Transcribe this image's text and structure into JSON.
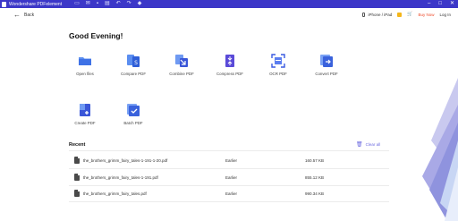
{
  "titlebar": {
    "app_title": "Wondershare PDFelement",
    "icons": [
      "open-file-icon",
      "mail-icon",
      "save-icon",
      "print-icon",
      "undo-icon",
      "redo-icon",
      "shield-icon"
    ],
    "window_controls": [
      "minimize-icon",
      "maximize-icon",
      "close-icon"
    ]
  },
  "header": {
    "back_label": "Back",
    "device_label": "iPhone / iPad",
    "buy_label": "Buy Now",
    "login_label": "Log In"
  },
  "greeting": "Good Evening!",
  "tools": [
    {
      "label": "Open files",
      "color": "#4a78e8"
    },
    {
      "label": "Compare PDF",
      "color": "#4a78e8"
    },
    {
      "label": "Combine PDF",
      "color": "#4a5ae0"
    },
    {
      "label": "Compress PDF",
      "color": "#5a4ae0"
    },
    {
      "label": "OCR PDF",
      "color": "#3a5ae0"
    },
    {
      "label": "Convert PDF",
      "color": "#4a6ae8"
    },
    {
      "label": "Create PDF",
      "color": "#4a5ae0"
    },
    {
      "label": "Batch PDF",
      "color": "#4a6ae8"
    }
  ],
  "recent": {
    "title": "Recent",
    "clear_label": "Clear all",
    "files": [
      {
        "name": "the_brothers_grimm_fairy_tales-1-191-1-20.pdf",
        "time": "Earlier",
        "size": "160.57 KB"
      },
      {
        "name": "the_brothers_grimm_fairy_tales-1-191.pdf",
        "time": "Earlier",
        "size": "855.12 KB"
      },
      {
        "name": "the_brothers_grimm_fairy_tales.pdf",
        "time": "Earlier",
        "size": "990.34 KB"
      }
    ]
  },
  "colors": {
    "titlebar": "#3c37c8",
    "accent": "#6c6ae0",
    "buy_now": "#ee4b2b"
  }
}
